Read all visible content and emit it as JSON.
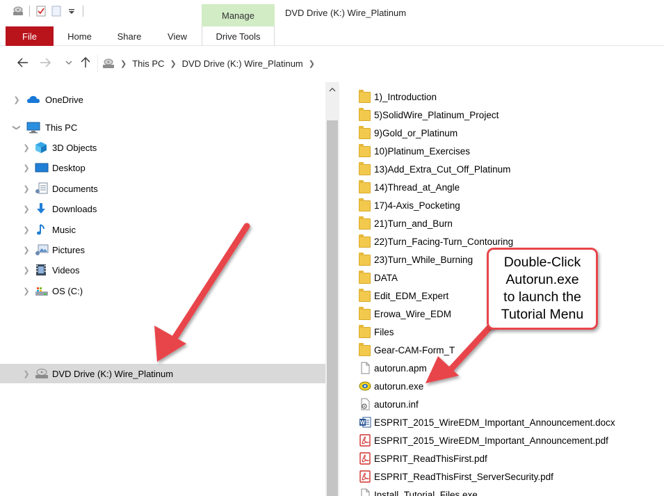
{
  "window": {
    "title": "DVD Drive (K:) Wire_Platinum",
    "context_tab_group": "Manage"
  },
  "ribbon": {
    "tabs": [
      {
        "label": "File"
      },
      {
        "label": "Home"
      },
      {
        "label": "Share"
      },
      {
        "label": "View"
      },
      {
        "label": "Drive Tools"
      }
    ]
  },
  "address": {
    "breadcrumbs": [
      "This PC",
      "DVD Drive (K:) Wire_Platinum"
    ]
  },
  "nav": {
    "items": [
      {
        "label": "OneDrive",
        "icon": "onedrive-cloud-icon"
      },
      {
        "label": "This PC",
        "icon": "computer-icon"
      },
      {
        "label": "3D Objects",
        "icon": "3d-objects-icon"
      },
      {
        "label": "Desktop",
        "icon": "desktop-icon"
      },
      {
        "label": "Documents",
        "icon": "documents-icon"
      },
      {
        "label": "Downloads",
        "icon": "downloads-icon"
      },
      {
        "label": "Music",
        "icon": "music-icon"
      },
      {
        "label": "Pictures",
        "icon": "pictures-icon"
      },
      {
        "label": "Videos",
        "icon": "videos-icon"
      },
      {
        "label": "OS (C:)",
        "icon": "drive-c-icon"
      },
      {
        "label": "DVD Drive (K:) Wire_Platinum",
        "icon": "dvd-drive-icon",
        "selected": true
      }
    ]
  },
  "files": [
    {
      "name": "1)_Introduction",
      "type": "folder"
    },
    {
      "name": "5)SolidWire_Platinum_Project",
      "type": "folder"
    },
    {
      "name": "9)Gold_or_Platinum",
      "type": "folder"
    },
    {
      "name": "10)Platinum_Exercises",
      "type": "folder"
    },
    {
      "name": "13)Add_Extra_Cut_Off_Platinum",
      "type": "folder"
    },
    {
      "name": "14)Thread_at_Angle",
      "type": "folder"
    },
    {
      "name": "17)4-Axis_Pocketing",
      "type": "folder"
    },
    {
      "name": "21)Turn_and_Burn",
      "type": "folder"
    },
    {
      "name": "22)Turn_Facing-Turn_Contouring",
      "type": "folder"
    },
    {
      "name": "23)Turn_While_Burning",
      "type": "folder"
    },
    {
      "name": "DATA",
      "type": "folder"
    },
    {
      "name": "Edit_EDM_Expert",
      "type": "folder"
    },
    {
      "name": "Erowa_Wire_EDM",
      "type": "folder"
    },
    {
      "name": "Files",
      "type": "folder"
    },
    {
      "name": "Gear-CAM-Form_T",
      "type": "folder"
    },
    {
      "name": "autorun.apm",
      "type": "file"
    },
    {
      "name": "autorun.exe",
      "type": "exe"
    },
    {
      "name": "autorun.inf",
      "type": "inf"
    },
    {
      "name": "ESPRIT_2015_WireEDM_Important_Announcement.docx",
      "type": "docx"
    },
    {
      "name": "ESPRIT_2015_WireEDM_Important_Announcement.pdf",
      "type": "pdf"
    },
    {
      "name": "ESPRIT_ReadThisFirst.pdf",
      "type": "pdf"
    },
    {
      "name": "ESPRIT_ReadThisFirst_ServerSecurity.pdf",
      "type": "pdf"
    },
    {
      "name": "Install_Tutorial_Files.exe",
      "type": "file"
    }
  ],
  "callout": {
    "text": "Double-Click\nAutorun.exe\nto launch the\nTutorial Menu"
  },
  "colors": {
    "file_tab": "#b9131c",
    "manage_tab": "#d2ecc6",
    "selected_nav": "#d9d9d9",
    "annotation": "#e8454b"
  }
}
